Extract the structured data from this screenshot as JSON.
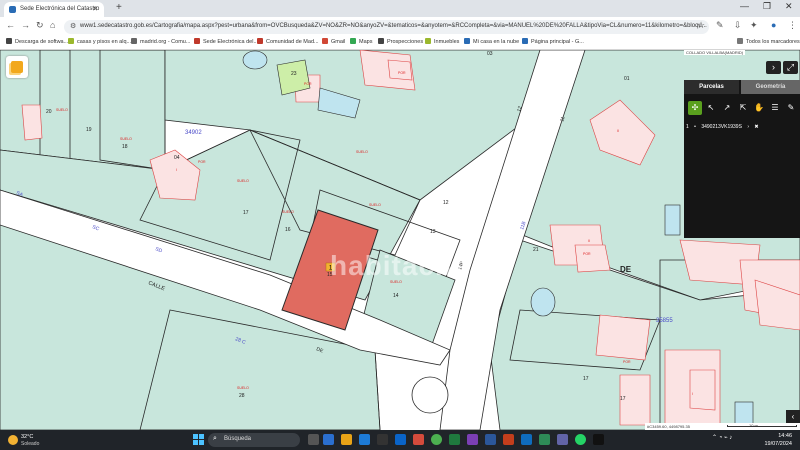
{
  "browser": {
    "tab_title": "Sede Electrónica del Catastro",
    "url": "www1.sedecatastro.gob.es/Cartografia/mapa.aspx?pest=urbana&from=OVCBusqueda&ZV=NO&ZR=NO&anyoZV=&tematicos=&anyotem=&RCCompleta=&via=MANUEL%20DE%20FALLA&tipoVia=CL&numero=11&kilometro=&bloqu..."
  },
  "bookmarks": [
    {
      "label": "Descarga de softwa...",
      "color": "#444444"
    },
    {
      "label": "casas y pisos en alq...",
      "color": "#9bb82d"
    },
    {
      "label": "madrid.org - Comu...",
      "color": "#666666"
    },
    {
      "label": "Sede Electrónica del...",
      "color": "#c0392b"
    },
    {
      "label": "Comunidad de Mad...",
      "color": "#c0392b"
    },
    {
      "label": "Gmail",
      "color": "#d14836"
    },
    {
      "label": "Maps",
      "color": "#34a853"
    },
    {
      "label": "Prospecciones",
      "color": "#444444"
    },
    {
      "label": "Inmuebles",
      "color": "#9bb82d"
    },
    {
      "label": "Mi casa en la nube",
      "color": "#2a6cb5"
    },
    {
      "label": "Página principal - G...",
      "color": "#2a6cb5"
    }
  ],
  "bookmarks_folder": "Todos los marcadores",
  "map": {
    "watermark": "habitaclia",
    "coord_label": "COLLADO VILLALBA(MADRID)",
    "block_numbers": [
      "34902",
      "35855"
    ],
    "street_word": "CALLE",
    "street_letters": [
      "SA",
      "SC",
      "SD",
      "28 C",
      "DE",
      "14P",
      "11B",
      "12",
      "11"
    ],
    "place_label": "DE",
    "parcel_numbers": [
      "20",
      "19",
      "18",
      "04",
      "17",
      "16",
      "15",
      "14",
      "12",
      "13",
      "21",
      "01",
      "17",
      "28",
      "03",
      "23",
      "17"
    ],
    "selected_badge": "1",
    "red_labels": [
      "SUELO",
      "SUELO",
      "SUELO",
      "SUELO",
      "SUELO",
      "SUELO",
      "SUELO",
      "SUELO",
      "POR",
      "POR",
      "POR",
      "POR",
      "POR",
      "I",
      "II",
      "II",
      "I"
    ],
    "scale_label": "#C3459.60, 4498795.35",
    "scale_unit": "10 m"
  },
  "panel": {
    "tabs": [
      "Parcelas",
      "Geometría"
    ],
    "parcel_index": "1",
    "parcel_ref": "3490213VK1939S"
  },
  "taskbar": {
    "weather_temp": "32°C",
    "weather_text": "Soleado",
    "search_placeholder": "Búsqueda",
    "time": "14:46",
    "date": "19/07/2024"
  },
  "colors": {
    "parcel_fill": "#c8e6dc",
    "parcel_line": "#2a2a2a",
    "building_fill": "#fbe3e3",
    "building_line": "#d44",
    "selected_fill": "#e06b60",
    "road": "#ffffff",
    "pool": "#bfe4ef",
    "green": "#cdeea8"
  }
}
